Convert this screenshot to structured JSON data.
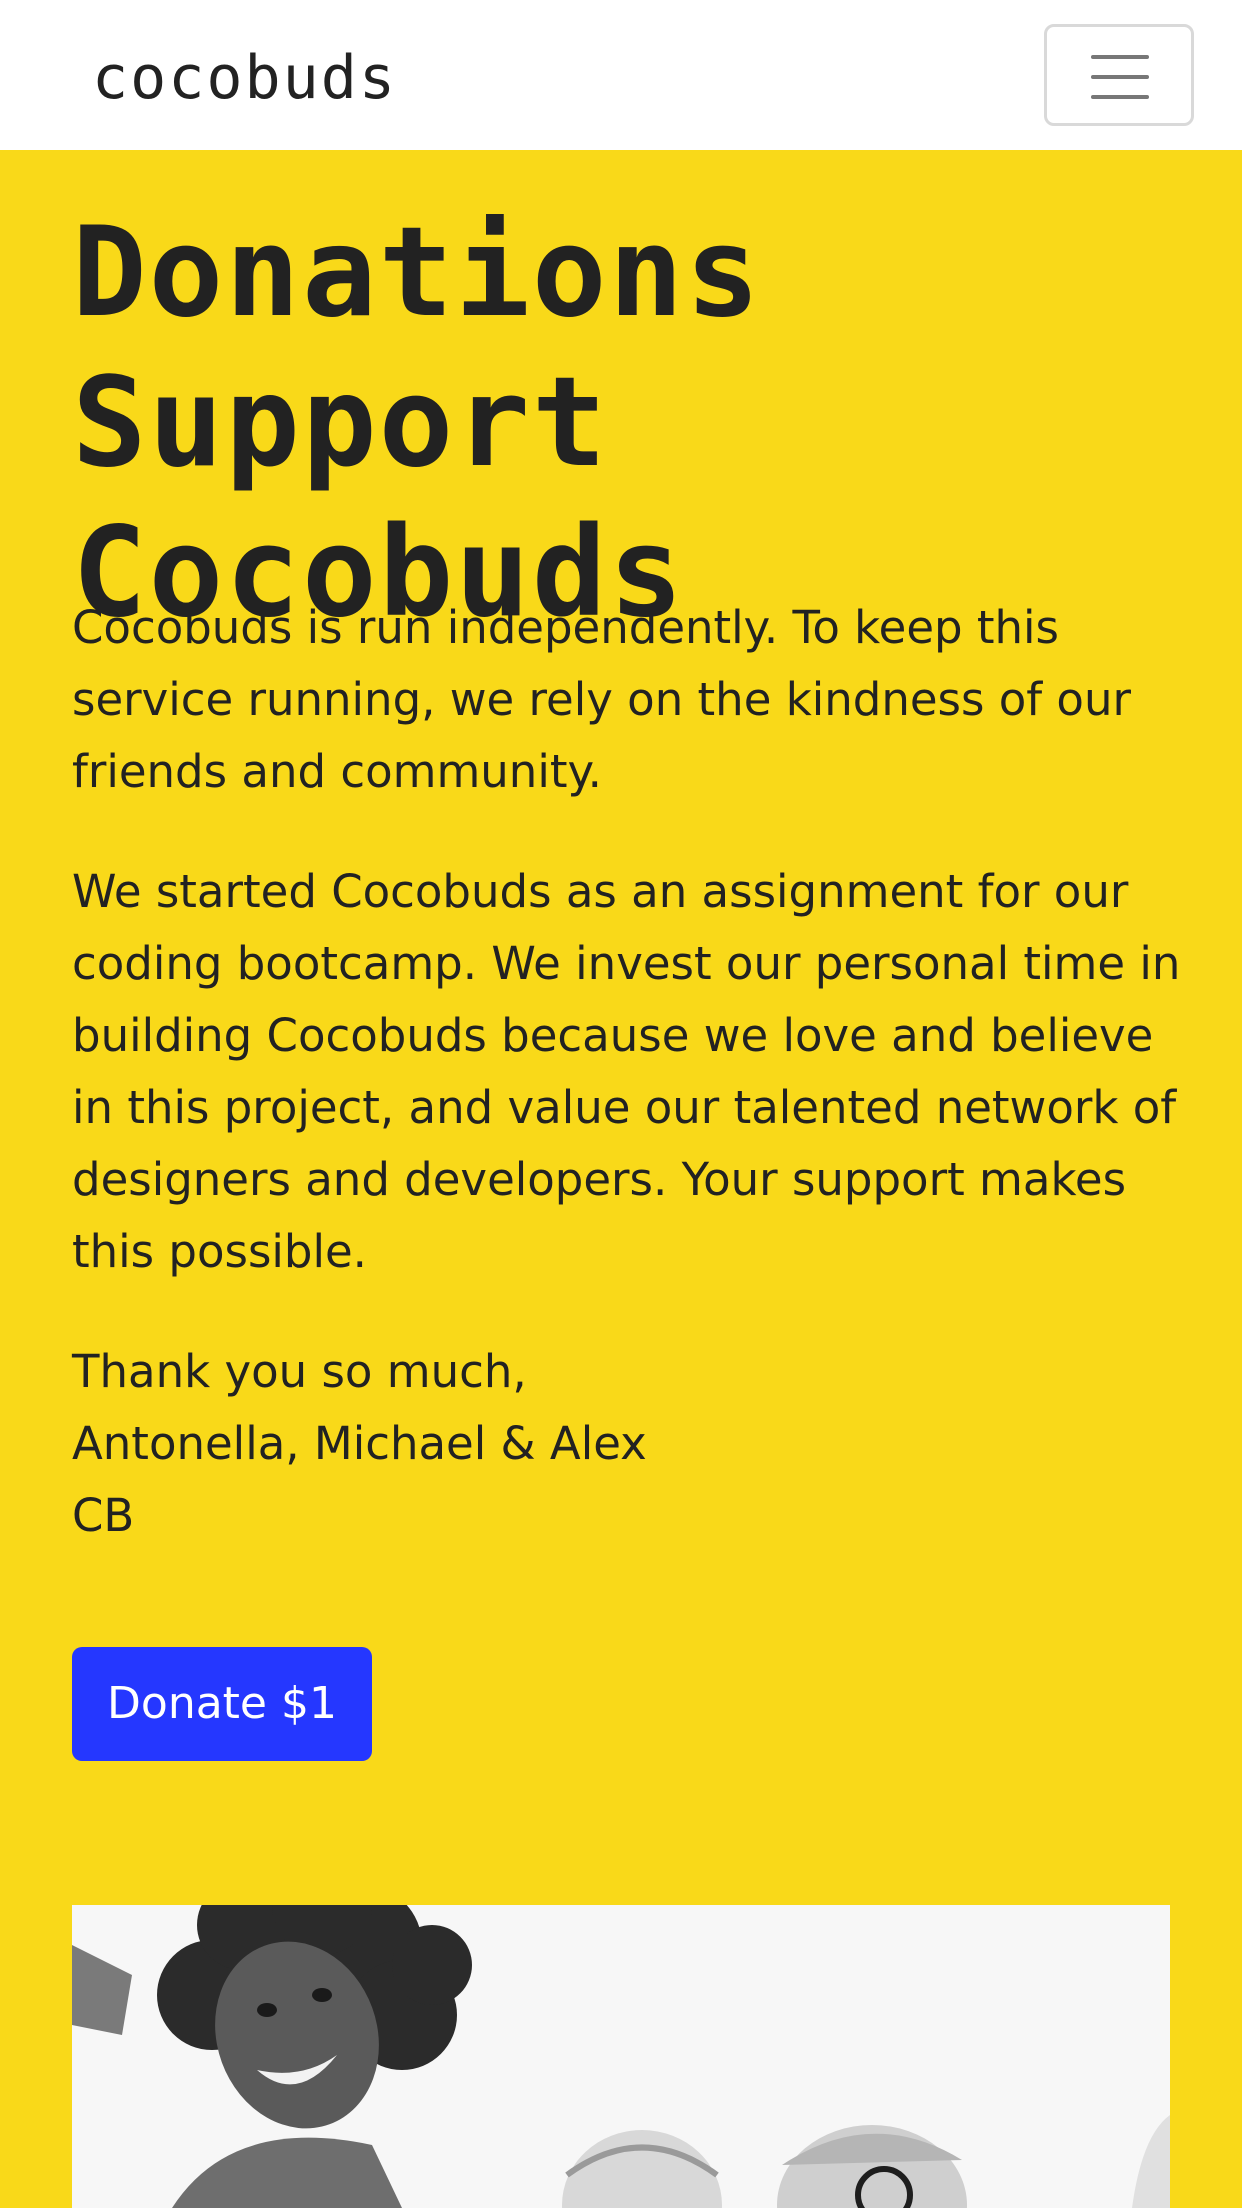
{
  "navbar": {
    "brand": "cocobuds",
    "menu_icon": "hamburger-menu-icon"
  },
  "hero": {
    "title": "Donations Support Cocobuds"
  },
  "content": {
    "paragraph_1": "Cocobuds is run independently. To keep this service running, we rely on the kindness of our friends and community.",
    "paragraph_2": "We started Cocobuds as an assignment for our coding bootcamp. We invest our personal time in building Cocobuds because we love and believe in this project, and value our talented network of designers and developers. Your support makes this possible.",
    "signoff": {
      "line_1": "Thank you so much,",
      "line_2": "Antonella, Michael & Alex",
      "line_3": "CB"
    }
  },
  "donate_button": {
    "label": "Donate $1"
  },
  "colors": {
    "background": "#f9d919",
    "navbar": "#ffffff",
    "text": "#222222",
    "button": "#2537ff",
    "button_text": "#ffffff"
  }
}
